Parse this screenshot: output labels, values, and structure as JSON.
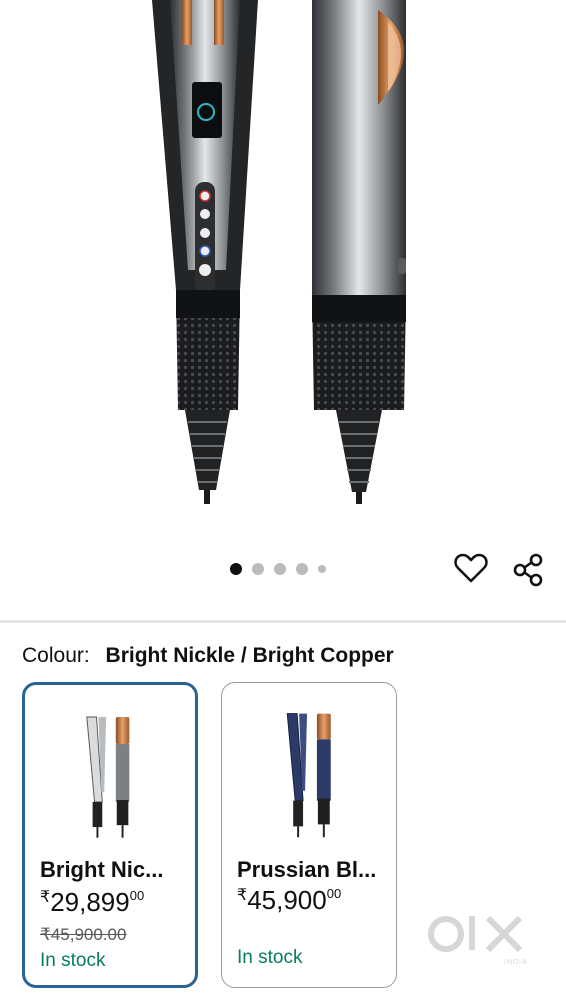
{
  "gallery": {
    "pages": 5,
    "current": 1
  },
  "actions": {
    "favourite_icon": "heart-outline-icon",
    "share_icon": "share-icon"
  },
  "variant": {
    "label": "Colour:",
    "selected": "Bright Nickle / Bright Copper"
  },
  "options": [
    {
      "title": "Bright Nic...",
      "currency": "₹",
      "price_whole": "29,899",
      "price_fraction": "00",
      "mrp": "₹45,900.00",
      "stock": "In stock",
      "selected": true
    },
    {
      "title": "Prussian Bl...",
      "currency": "₹",
      "price_whole": "45,900",
      "price_fraction": "00",
      "stock": "In stock",
      "selected": false
    }
  ],
  "watermark": {
    "brand": "OLX",
    "sub": "INDIA"
  },
  "colors": {
    "selected_border": "#2a6496",
    "stock_green": "#067d62",
    "copper": "#c97a3d",
    "nickel": "#9aa0a3",
    "prussian": "#2b3a66"
  }
}
